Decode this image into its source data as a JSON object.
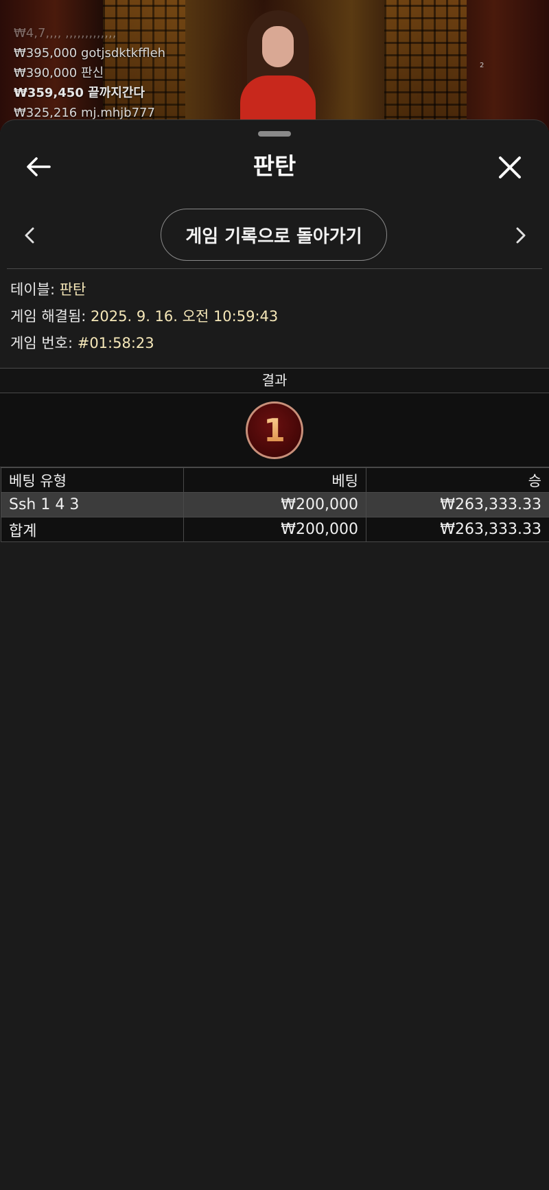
{
  "leaderboard": [
    {
      "text": "₩4,7,,,, ,,,,,,,,,,,,,",
      "faded": true
    },
    {
      "text": "₩395,000 gotjsdktkffleh"
    },
    {
      "text": "₩390,000 판신"
    },
    {
      "text": "₩359,450 끝까지간다",
      "bold": true
    },
    {
      "text": "₩325,216 mj.mhjb777"
    }
  ],
  "stream_badge": "2",
  "header": {
    "title": "판탄"
  },
  "nav": {
    "history_label": "게임 기록으로 돌아가기"
  },
  "info": {
    "table_label": "테이블:",
    "table_value": "판탄",
    "resolved_label": "게임 해결됨:",
    "resolved_value": "2025. 9. 16. 오전 10:59:43",
    "game_no_label": "게임 번호:",
    "game_no_value": "#01:58:23"
  },
  "result": {
    "header": "결과",
    "number": "1"
  },
  "bets_table": {
    "columns": [
      "베팅 유형",
      "베팅",
      "승"
    ],
    "rows": [
      {
        "type": "Ssh 1 4 3",
        "bet": "₩200,000",
        "win": "₩263,333.33"
      },
      {
        "type": "합계",
        "bet": "₩200,000",
        "win": "₩263,333.33"
      }
    ]
  },
  "colors": {
    "accent_value": "#f5e7b8",
    "sheet_bg": "#1b1b1b",
    "ball_red": "#4a0808"
  }
}
